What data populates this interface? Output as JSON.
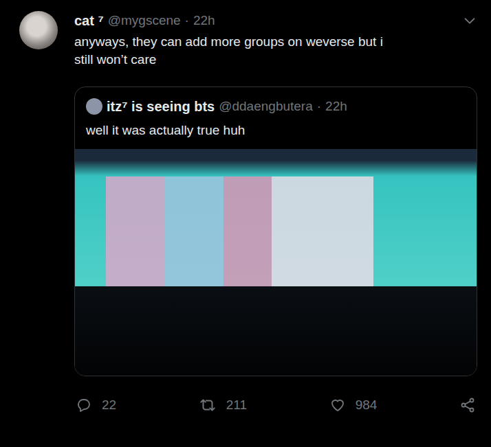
{
  "tweet": {
    "author": {
      "name": "cat ⁷",
      "handle": "@mygscene",
      "separator": "·",
      "time": "22h"
    },
    "text": "anyways, they can add more groups on weverse but i still won’t care",
    "quoted": {
      "author": {
        "name": "itz⁷ is seeing bts",
        "handle": "@ddaengbutera",
        "separator": "·",
        "time": "22h"
      },
      "text": "well it was actually true huh",
      "has_photo": true
    },
    "stats": {
      "replies": "22",
      "retweets": "211",
      "likes": "984"
    }
  }
}
